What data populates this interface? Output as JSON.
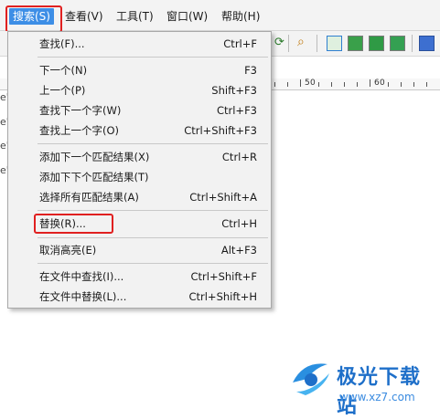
{
  "menubar": {
    "items": [
      {
        "label": "搜索(S)",
        "active": true
      },
      {
        "label": "查看(V)"
      },
      {
        "label": "工具(T)"
      },
      {
        "label": "窗口(W)"
      },
      {
        "label": "帮助(H)"
      }
    ]
  },
  "search_menu": {
    "find": {
      "label": "查找(F)...",
      "shortcut": "Ctrl+F"
    },
    "find_next": {
      "label": "下一个(N)",
      "shortcut": "F3"
    },
    "find_prev": {
      "label": "上一个(P)",
      "shortcut": "Shift+F3"
    },
    "find_next_word": {
      "label": "查找下一个字(W)",
      "shortcut": "Ctrl+F3"
    },
    "find_prev_word": {
      "label": "查找上一个字(O)",
      "shortcut": "Ctrl+Shift+F3"
    },
    "add_next_match": {
      "label": "添加下一个匹配结果(X)",
      "shortcut": "Ctrl+R"
    },
    "add_next_next_match": {
      "label": "添加下下个匹配结果(T)",
      "shortcut": ""
    },
    "select_all_matches": {
      "label": "选择所有匹配结果(A)",
      "shortcut": "Ctrl+Shift+A"
    },
    "replace": {
      "label": "替换(R)...",
      "shortcut": "Ctrl+H"
    },
    "clear_highlight": {
      "label": "取消高亮(E)",
      "shortcut": "Alt+F3"
    },
    "find_in_files": {
      "label": "在文件中查找(I)...",
      "shortcut": "Ctrl+Shift+F"
    },
    "replace_in_files": {
      "label": "在文件中替换(L)...",
      "shortcut": "Ctrl+Shift+H"
    }
  },
  "ruler": {
    "labels": [
      "5",
      "0",
      "6",
      "0"
    ]
  },
  "editor_left_glyph": "e\"",
  "watermark": {
    "brand": "极光下载站",
    "url": "www.xz7.com"
  },
  "colors": {
    "highlight_box": "#e02020",
    "active_menu": "#3d8ee6",
    "watermark": "#1e6fc9"
  }
}
